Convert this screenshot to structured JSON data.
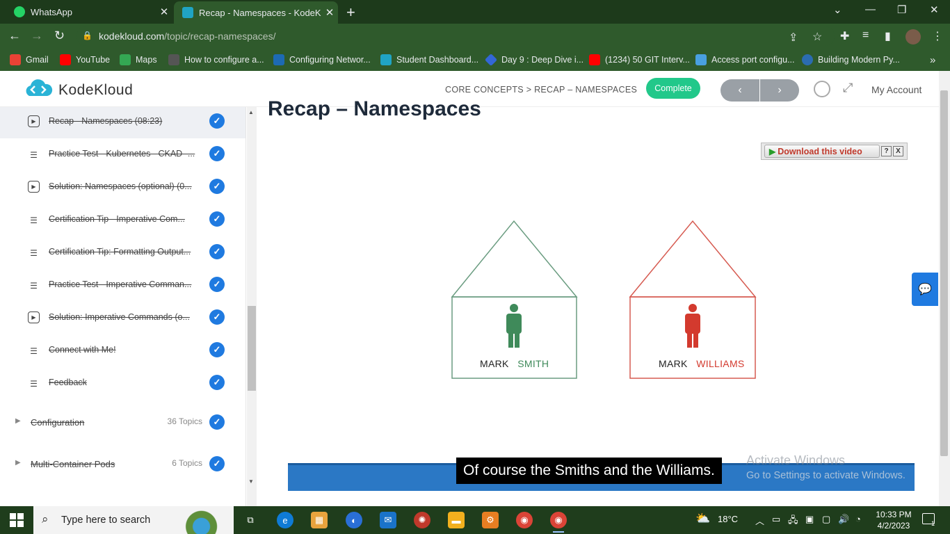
{
  "browser": {
    "tabs": [
      {
        "title": "WhatsApp",
        "favicon": "whatsapp-icon"
      },
      {
        "title": "Recap - Namespaces - KodeKlou",
        "favicon": "kodekloud-icon"
      }
    ],
    "url_host": "kodekloud.com",
    "url_path": "/topic/recap-namespaces/",
    "bookmarks": [
      {
        "label": "Gmail",
        "icon": "gmail-icon",
        "color": "#e94235"
      },
      {
        "label": "YouTube",
        "icon": "youtube-icon",
        "color": "#ff0000"
      },
      {
        "label": "Maps",
        "icon": "maps-icon",
        "color": "#34a853"
      },
      {
        "label": "How to configure a...",
        "icon": "page-icon",
        "color": "#555555"
      },
      {
        "label": "Configuring Networ...",
        "icon": "vmware-icon",
        "color": "#1d6ab4"
      },
      {
        "label": "Student Dashboard...",
        "icon": "kodekloud-icon",
        "color": "#20a4c4"
      },
      {
        "label": "Day 9 : Deep Dive i...",
        "icon": "diamond-icon",
        "color": "#3367d6"
      },
      {
        "label": "(1234) 50 GIT Interv...",
        "icon": "youtube-icon",
        "color": "#ff0000"
      },
      {
        "label": "Access port configu...",
        "icon": "arrow-icon",
        "color": "#49a0e0"
      },
      {
        "label": "Building Modern Py...",
        "icon": "c-icon",
        "color": "#2b6cb0"
      }
    ]
  },
  "header": {
    "brand": "KodeKloud",
    "breadcrumb": "CORE CONCEPTS > RECAP – NAMESPACES",
    "complete_label": "Complete",
    "prev_label": "‹",
    "next_label": "›",
    "account_label": "My Account"
  },
  "sidebar": {
    "lessons": [
      {
        "title": "Recap - Namespaces (08:23)",
        "type": "video",
        "done": true
      },
      {
        "title": "Practice Test - Kubernetes - CKAD -...",
        "type": "text",
        "done": true
      },
      {
        "title": "Solution: Namespaces (optional) (0...",
        "type": "video",
        "done": true
      },
      {
        "title": "Certification Tip - Imperative Com...",
        "type": "text",
        "done": true
      },
      {
        "title": "Certification Tip: Formatting Output...",
        "type": "text",
        "done": true
      },
      {
        "title": "Practice Test - Imperative Comman...",
        "type": "text",
        "done": true
      },
      {
        "title": "Solution: Imperative Commands (o...",
        "type": "video",
        "done": true
      },
      {
        "title": "Connect with Me!",
        "type": "text",
        "done": true
      },
      {
        "title": "Feedback",
        "type": "text",
        "done": true
      }
    ],
    "topics": [
      {
        "name": "Configuration",
        "count": "36 Topics"
      },
      {
        "name": "Multi-Container Pods",
        "count": "6 Topics"
      }
    ]
  },
  "main": {
    "title": "Recap – Namespaces",
    "download_label": "Download this video",
    "download_help": "?",
    "download_close": "X",
    "house_left": {
      "first": "MARK",
      "last": "SMITH",
      "color": "#3f8a5a"
    },
    "house_right": {
      "first": "MARK",
      "last": "WILLIAMS",
      "color": "#d33a2e"
    },
    "caption": "Of course the Smiths and the Williams.",
    "watermark_title": "Activate Windows",
    "watermark_sub": "Go to Settings to activate Windows."
  },
  "taskbar": {
    "search_placeholder": "Type here to search",
    "weather": "18°C",
    "time": "10:33 PM",
    "date": "4/2/2023",
    "notification_count": "1"
  }
}
